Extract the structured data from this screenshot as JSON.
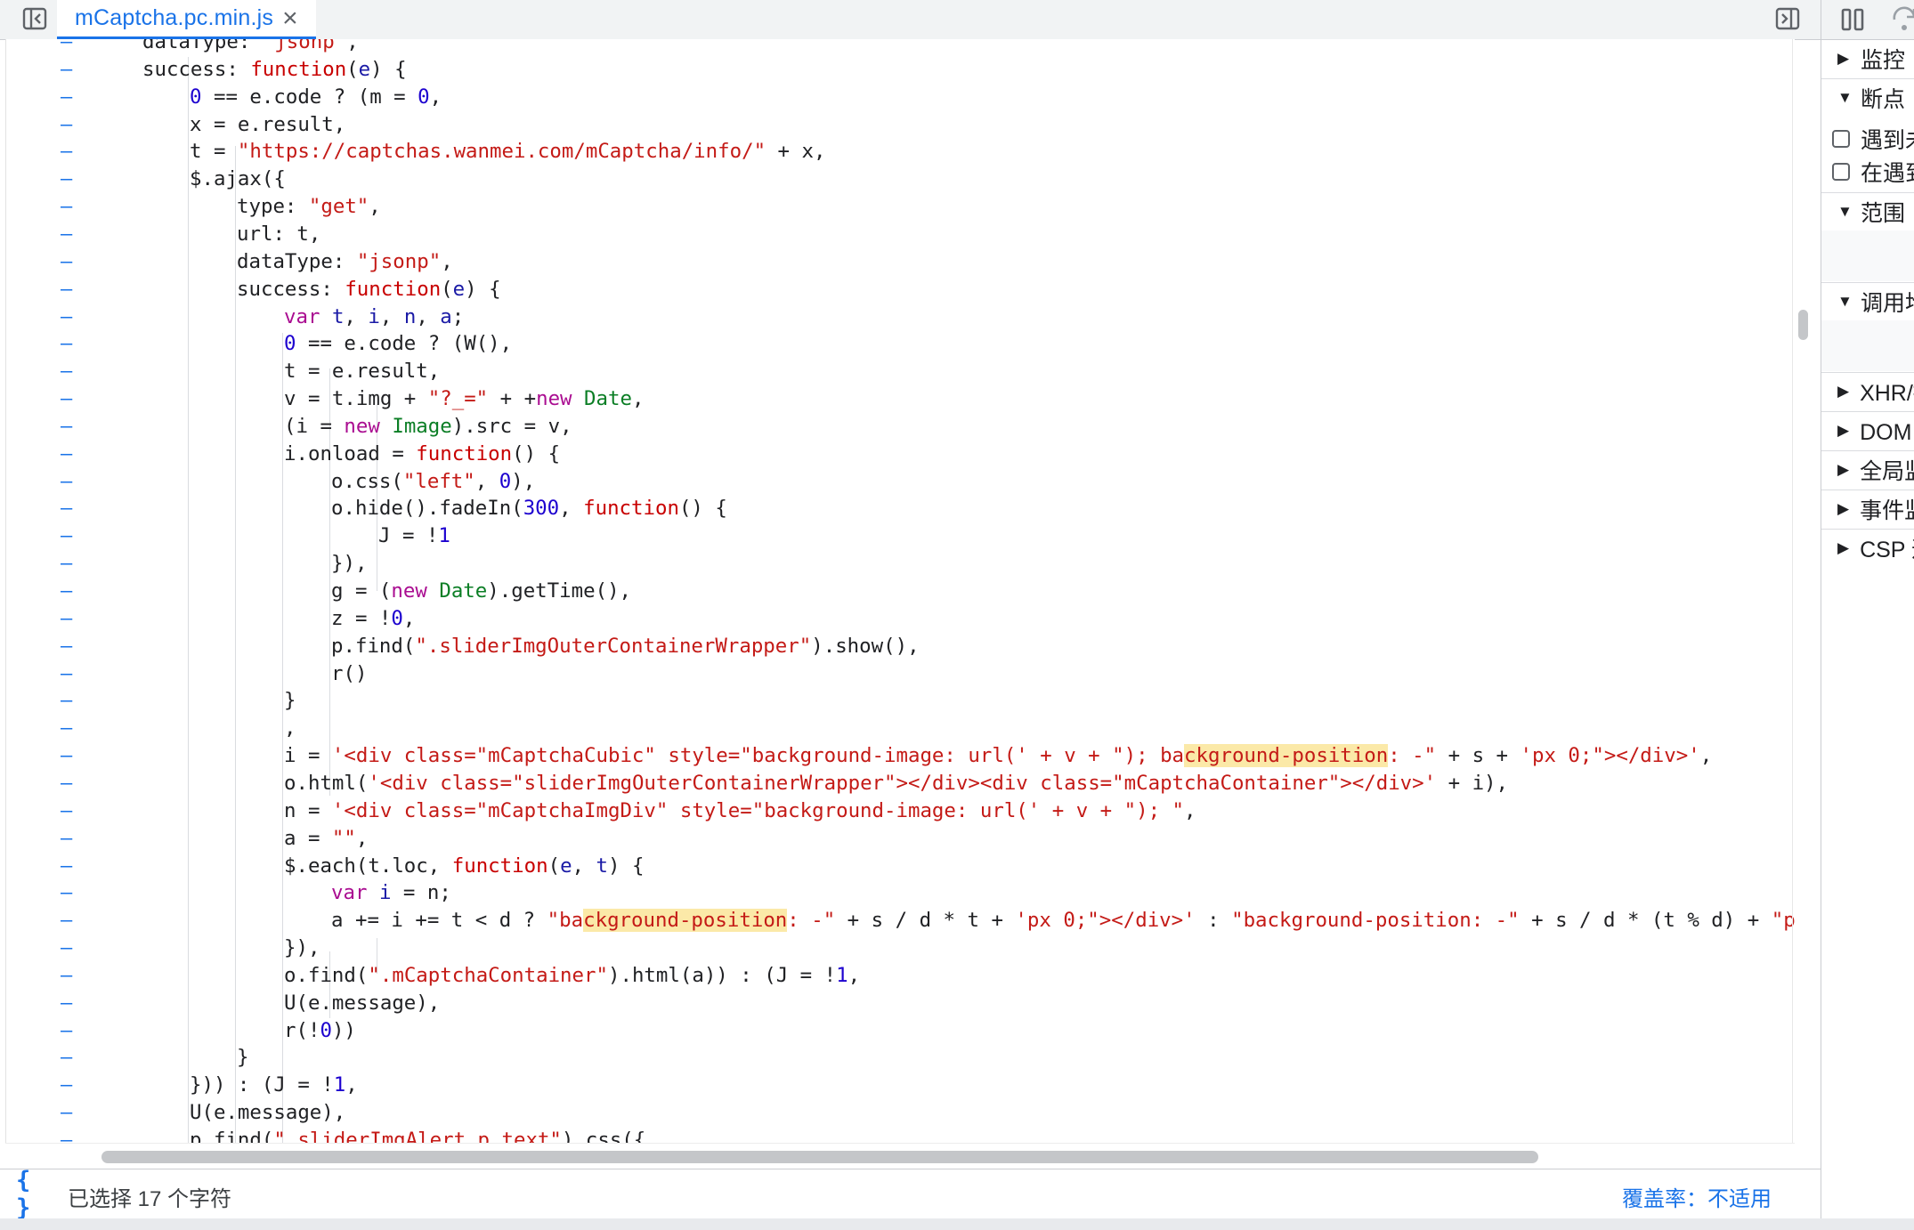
{
  "tab": {
    "file_name": "mCaptcha.pc.min.js",
    "close_glyph": "×"
  },
  "editor": {
    "lines": [
      {
        "indent": 2,
        "tokens": [
          {
            "t": "dataType: "
          },
          {
            "t": "\"jsonp\"",
            "c": "str"
          },
          {
            "t": ","
          }
        ]
      },
      {
        "indent": 2,
        "tokens": [
          {
            "t": "success: "
          },
          {
            "t": "function",
            "c": "kw2"
          },
          {
            "t": "("
          },
          {
            "t": "e",
            "c": "var"
          },
          {
            "t": ") {"
          }
        ]
      },
      {
        "indent": 3,
        "tokens": [
          {
            "t": "0",
            "c": "num"
          },
          {
            "t": " == e.code ? (m = "
          },
          {
            "t": "0",
            "c": "num"
          },
          {
            "t": ","
          }
        ]
      },
      {
        "indent": 3,
        "tokens": [
          {
            "t": "x = e.result,"
          }
        ]
      },
      {
        "indent": 3,
        "tokens": [
          {
            "t": "t = "
          },
          {
            "t": "\"https://captchas.wanmei.com/mCaptcha/info/\"",
            "c": "str"
          },
          {
            "t": " + x,"
          }
        ]
      },
      {
        "indent": 3,
        "tokens": [
          {
            "t": "$.ajax({"
          }
        ]
      },
      {
        "indent": 4,
        "tokens": [
          {
            "t": "type: "
          },
          {
            "t": "\"get\"",
            "c": "str"
          },
          {
            "t": ","
          }
        ]
      },
      {
        "indent": 4,
        "tokens": [
          {
            "t": "url: t,"
          }
        ]
      },
      {
        "indent": 4,
        "tokens": [
          {
            "t": "dataType: "
          },
          {
            "t": "\"jsonp\"",
            "c": "str"
          },
          {
            "t": ","
          }
        ]
      },
      {
        "indent": 4,
        "tokens": [
          {
            "t": "success: "
          },
          {
            "t": "function",
            "c": "kw2"
          },
          {
            "t": "("
          },
          {
            "t": "e",
            "c": "var"
          },
          {
            "t": ") {"
          }
        ]
      },
      {
        "indent": 5,
        "tokens": [
          {
            "t": "var",
            "c": "kw"
          },
          {
            "t": " "
          },
          {
            "t": "t",
            "c": "var"
          },
          {
            "t": ", "
          },
          {
            "t": "i",
            "c": "var"
          },
          {
            "t": ", "
          },
          {
            "t": "n",
            "c": "var"
          },
          {
            "t": ", "
          },
          {
            "t": "a",
            "c": "var"
          },
          {
            "t": ";"
          }
        ]
      },
      {
        "indent": 5,
        "tokens": [
          {
            "t": "0",
            "c": "num"
          },
          {
            "t": " == e.code ? (W(),"
          }
        ]
      },
      {
        "indent": 5,
        "tokens": [
          {
            "t": "t = e.result,"
          }
        ]
      },
      {
        "indent": 5,
        "tokens": [
          {
            "t": "v = t.img + "
          },
          {
            "t": "\"?_=\"",
            "c": "str"
          },
          {
            "t": " + +"
          },
          {
            "t": "new",
            "c": "kw"
          },
          {
            "t": " "
          },
          {
            "t": "Date",
            "c": "cls"
          },
          {
            "t": ","
          }
        ]
      },
      {
        "indent": 5,
        "tokens": [
          {
            "t": "(i = "
          },
          {
            "t": "new",
            "c": "kw"
          },
          {
            "t": " "
          },
          {
            "t": "Image",
            "c": "cls"
          },
          {
            "t": ").src = v,"
          }
        ]
      },
      {
        "indent": 5,
        "tokens": [
          {
            "t": "i.onload = "
          },
          {
            "t": "function",
            "c": "kw2"
          },
          {
            "t": "() {"
          }
        ]
      },
      {
        "indent": 6,
        "tokens": [
          {
            "t": "o.css("
          },
          {
            "t": "\"left\"",
            "c": "str"
          },
          {
            "t": ", "
          },
          {
            "t": "0",
            "c": "num"
          },
          {
            "t": "),"
          }
        ]
      },
      {
        "indent": 6,
        "tokens": [
          {
            "t": "o.hide().fadeIn("
          },
          {
            "t": "300",
            "c": "num"
          },
          {
            "t": ", "
          },
          {
            "t": "function",
            "c": "kw2"
          },
          {
            "t": "() {"
          }
        ]
      },
      {
        "indent": 7,
        "tokens": [
          {
            "t": "J = !"
          },
          {
            "t": "1",
            "c": "num"
          }
        ]
      },
      {
        "indent": 6,
        "tokens": [
          {
            "t": "}),"
          }
        ]
      },
      {
        "indent": 6,
        "tokens": [
          {
            "t": "g = ("
          },
          {
            "t": "new",
            "c": "kw"
          },
          {
            "t": " "
          },
          {
            "t": "Date",
            "c": "cls"
          },
          {
            "t": ").getTime(),"
          }
        ]
      },
      {
        "indent": 6,
        "tokens": [
          {
            "t": "z = !"
          },
          {
            "t": "0",
            "c": "num"
          },
          {
            "t": ","
          }
        ]
      },
      {
        "indent": 6,
        "tokens": [
          {
            "t": "p.find("
          },
          {
            "t": "\".sliderImgOuterContainerWrapper\"",
            "c": "str"
          },
          {
            "t": ").show(),"
          }
        ]
      },
      {
        "indent": 6,
        "tokens": [
          {
            "t": "r()"
          }
        ]
      },
      {
        "indent": 5,
        "tokens": [
          {
            "t": "}"
          }
        ]
      },
      {
        "indent": 5,
        "tokens": [
          {
            "t": ","
          }
        ]
      },
      {
        "indent": 5,
        "tokens": [
          {
            "t": "i = "
          },
          {
            "t": "'<div class=\"mCaptchaCubic\" style=\"background-image: url(' + v + \"); ba",
            "c": "str"
          },
          {
            "t": "ckground-position",
            "c": "str hl"
          },
          {
            "t": ": -\"",
            "c": "str"
          },
          {
            "t": " + s + "
          },
          {
            "t": "'px 0;\"></div>'",
            "c": "str"
          },
          {
            "t": ","
          }
        ]
      },
      {
        "indent": 5,
        "tokens": [
          {
            "t": "o.html("
          },
          {
            "t": "'<div class=\"sliderImgOuterContainerWrapper\"></div><div class=\"mCaptchaContainer\"></div>'",
            "c": "str"
          },
          {
            "t": " + i),"
          }
        ]
      },
      {
        "indent": 5,
        "tokens": [
          {
            "t": "n = "
          },
          {
            "t": "'<div class=\"mCaptchaImgDiv\" style=\"background-image: url(' + v + \"); \"",
            "c": "str"
          },
          {
            "t": ","
          }
        ]
      },
      {
        "indent": 5,
        "tokens": [
          {
            "t": "a = "
          },
          {
            "t": "\"\"",
            "c": "str"
          },
          {
            "t": ","
          }
        ]
      },
      {
        "indent": 5,
        "tokens": [
          {
            "t": "$.each(t.loc, "
          },
          {
            "t": "function",
            "c": "kw2"
          },
          {
            "t": "("
          },
          {
            "t": "e",
            "c": "var"
          },
          {
            "t": ", "
          },
          {
            "t": "t",
            "c": "var"
          },
          {
            "t": ") {"
          }
        ]
      },
      {
        "indent": 6,
        "tokens": [
          {
            "t": "var",
            "c": "kw"
          },
          {
            "t": " "
          },
          {
            "t": "i",
            "c": "var"
          },
          {
            "t": " = n;"
          }
        ]
      },
      {
        "indent": 6,
        "tokens": [
          {
            "t": "a += i += t < d ? "
          },
          {
            "t": "\"ba",
            "c": "str"
          },
          {
            "t": "ckground-position",
            "c": "str hl"
          },
          {
            "t": ": -\"",
            "c": "str"
          },
          {
            "t": " + s / d * t + "
          },
          {
            "t": "'px 0;\"></div>'",
            "c": "str"
          },
          {
            "t": " : "
          },
          {
            "t": "\"background-position: -\"",
            "c": "str"
          },
          {
            "t": " + s / d * (t % d) + "
          },
          {
            "t": "\"px",
            "c": "str"
          }
        ]
      },
      {
        "indent": 5,
        "tokens": [
          {
            "t": "}),"
          }
        ]
      },
      {
        "indent": 5,
        "tokens": [
          {
            "t": "o.find("
          },
          {
            "t": "\".mCaptchaContainer\"",
            "c": "str"
          },
          {
            "t": ").html(a)) : (J = !"
          },
          {
            "t": "1",
            "c": "num"
          },
          {
            "t": ","
          }
        ]
      },
      {
        "indent": 5,
        "tokens": [
          {
            "t": "U(e.message),"
          }
        ]
      },
      {
        "indent": 5,
        "tokens": [
          {
            "t": "r(!"
          },
          {
            "t": "0",
            "c": "num"
          },
          {
            "t": "))"
          }
        ]
      },
      {
        "indent": 4,
        "tokens": [
          {
            "t": "}"
          }
        ]
      },
      {
        "indent": 3,
        "tokens": [
          {
            "t": "})) : (J = !"
          },
          {
            "t": "1",
            "c": "num"
          },
          {
            "t": ","
          }
        ]
      },
      {
        "indent": 3,
        "tokens": [
          {
            "t": "U(e.message),"
          }
        ]
      },
      {
        "indent": 3,
        "tokens": [
          {
            "t": "p.find("
          },
          {
            "t": "\".sliderImgAlert p.text\"",
            "c": "str"
          },
          {
            "t": ").css({"
          }
        ]
      }
    ]
  },
  "statusbar": {
    "pretty_print_glyph": "{ }",
    "selection": "已选择 17 个字符",
    "coverage": "覆盖率：不适用"
  },
  "sidebar": {
    "sections": [
      {
        "label": "监控",
        "expanded": false
      },
      {
        "label": "断点",
        "expanded": true
      },
      {
        "label": "范围",
        "expanded": true
      },
      {
        "label": "调用堆栈",
        "expanded": true
      },
      {
        "label": "XHR/提取断点",
        "expanded": false
      },
      {
        "label": "DOM 断点",
        "expanded": false
      },
      {
        "label": "全局监听器",
        "expanded": false
      },
      {
        "label": "事件监听器断点",
        "expanded": false
      },
      {
        "label": "CSP 违规断点",
        "expanded": false
      }
    ],
    "checkboxes": [
      {
        "label": "遇到未捕获的异常时暂停",
        "checked": false
      },
      {
        "label": "在遇到异常时暂停",
        "checked": false
      }
    ]
  }
}
